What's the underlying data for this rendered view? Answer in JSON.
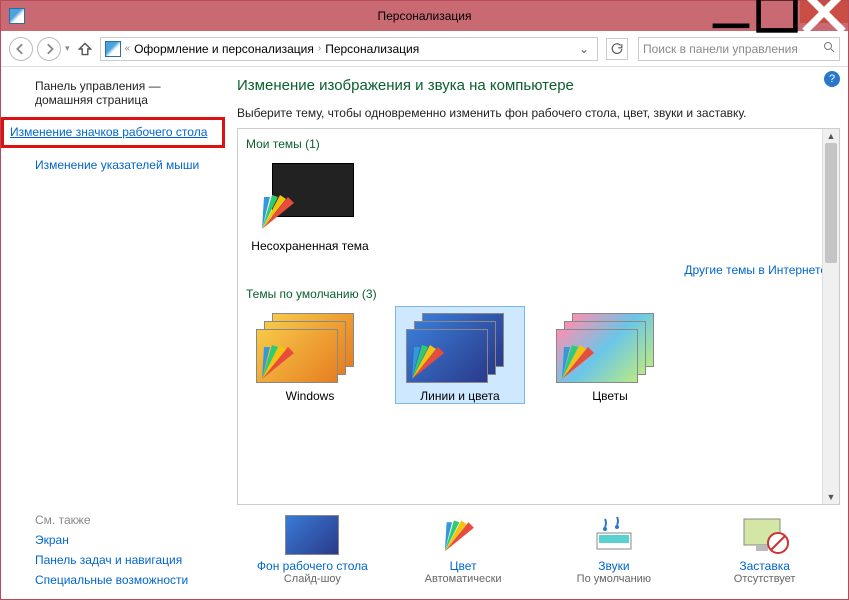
{
  "window": {
    "title": "Персонализация"
  },
  "nav": {
    "crumb1": "Оформление и персонализация",
    "crumb2": "Персонализация",
    "search_placeholder": "Поиск в панели управления"
  },
  "sidebar": {
    "heading_line1": "Панель управления —",
    "heading_line2": "домашняя страница",
    "link_desktop_icons": "Изменение значков рабочего стола",
    "link_mouse_pointers": "Изменение указателей мыши"
  },
  "seealso": {
    "heading": "См. также",
    "links": [
      "Экран",
      "Панель задач и навигация",
      "Специальные возможности"
    ]
  },
  "main": {
    "heading": "Изменение изображения и звука на компьютере",
    "subtext": "Выберите тему, чтобы одновременно изменить фон рабочего стола, цвет, звуки и заставку.",
    "section_my_themes": "Мои темы (1)",
    "theme_unsaved": "Несохраненная тема",
    "more_themes": "Другие темы в Интернете",
    "section_default_themes": "Темы по умолчанию (3)",
    "theme_windows": "Windows",
    "theme_lines": "Линии и цвета",
    "theme_flowers": "Цветы"
  },
  "bottom": {
    "bg_label": "Фон рабочего стола",
    "bg_sub": "Слайд-шоу",
    "color_label": "Цвет",
    "color_sub": "Автоматически",
    "sounds_label": "Звуки",
    "sounds_sub": "По умолчанию",
    "saver_label": "Заставка",
    "saver_sub": "Отсутствует"
  }
}
